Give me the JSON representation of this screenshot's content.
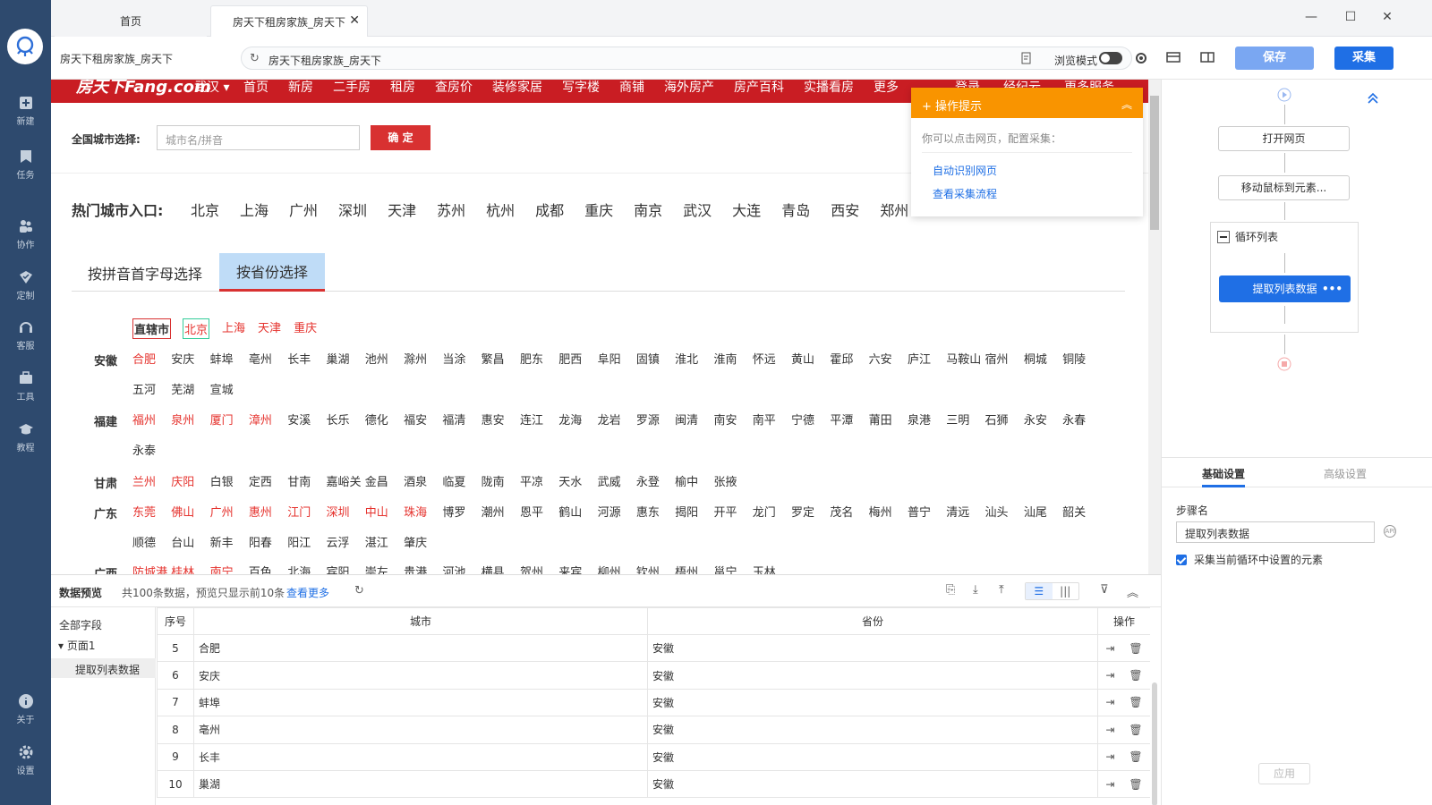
{
  "tabs": {
    "home": "首页",
    "active": "房天下租房家族_房天下"
  },
  "address": {
    "title": "房天下租房家族_房天下",
    "url": "房天下租房家族_房天下",
    "browse_mode": "浏览模式"
  },
  "toolbar": {
    "save_label": "保存",
    "collect_label": "采集"
  },
  "sidebar": {
    "items": [
      {
        "label": "新建",
        "icon": "new-icon"
      },
      {
        "label": "任务",
        "icon": "task-icon"
      },
      {
        "label": "协作",
        "icon": "collab-icon"
      },
      {
        "label": "定制",
        "icon": "custom-icon"
      },
      {
        "label": "客服",
        "icon": "headset-icon"
      },
      {
        "label": "工具",
        "icon": "toolbox-icon"
      },
      {
        "label": "教程",
        "icon": "tutorial-icon"
      },
      {
        "label": "关于",
        "icon": "info-icon"
      },
      {
        "label": "设置",
        "icon": "gear-icon"
      }
    ]
  },
  "site": {
    "logo": "房天下Fang.com",
    "city": "武汉",
    "nav": [
      "首页",
      "新房",
      "二手房",
      "租房",
      "查房价",
      "装修家居",
      "写字楼",
      "商铺",
      "海外房产",
      "房产百科",
      "实播看房",
      "更多"
    ],
    "nav_right": [
      "登录",
      "经纪云",
      "更多服务"
    ],
    "city_select_label": "全国城市选择:",
    "city_input_placeholder": "城市名/拼音",
    "confirm": "确 定",
    "hot_label": "热门城市入口:",
    "hot_cities": [
      "北京",
      "上海",
      "广州",
      "深圳",
      "天津",
      "苏州",
      "杭州",
      "成都",
      "重庆",
      "南京",
      "武汉",
      "大连",
      "青岛",
      "西安",
      "郑州"
    ],
    "tab_pinyin": "按拼音首字母选择",
    "tab_province": "按省份选择",
    "direct_label": "直辖市",
    "direct_cities": [
      "北京",
      "上海",
      "天津",
      "重庆"
    ],
    "provinces": [
      {
        "name": "安徽",
        "rows": [
          [
            "合肥",
            "安庆",
            "蚌埠",
            "亳州",
            "长丰",
            "巢湖",
            "池州",
            "滁州",
            "当涂",
            "繁昌",
            "肥东",
            "肥西",
            "阜阳",
            "固镇",
            "淮北",
            "淮南",
            "怀远",
            "黄山",
            "霍邱",
            "六安",
            "庐江",
            "马鞍山",
            "宿州",
            "桐城",
            "铜陵"
          ],
          [
            "五河",
            "芜湖",
            "宣城"
          ]
        ],
        "red_count": 1
      },
      {
        "name": "福建",
        "rows": [
          [
            "福州",
            "泉州",
            "厦门",
            "漳州",
            "安溪",
            "长乐",
            "德化",
            "福安",
            "福清",
            "惠安",
            "连江",
            "龙海",
            "龙岩",
            "罗源",
            "闽清",
            "南安",
            "南平",
            "宁德",
            "平潭",
            "莆田",
            "泉港",
            "三明",
            "石狮",
            "永安",
            "永春"
          ],
          [
            "永泰"
          ]
        ],
        "red_count": 4
      },
      {
        "name": "甘肃",
        "rows": [
          [
            "兰州",
            "庆阳",
            "白银",
            "定西",
            "甘南",
            "嘉峪关",
            "金昌",
            "酒泉",
            "临夏",
            "陇南",
            "平凉",
            "天水",
            "武威",
            "永登",
            "榆中",
            "张掖"
          ]
        ],
        "red_count": 2
      },
      {
        "name": "广东",
        "rows": [
          [
            "东莞",
            "佛山",
            "广州",
            "惠州",
            "江门",
            "深圳",
            "中山",
            "珠海",
            "博罗",
            "潮州",
            "恩平",
            "鹤山",
            "河源",
            "惠东",
            "揭阳",
            "开平",
            "龙门",
            "罗定",
            "茂名",
            "梅州",
            "普宁",
            "清远",
            "汕头",
            "汕尾",
            "韶关"
          ],
          [
            "顺德",
            "台山",
            "新丰",
            "阳春",
            "阳江",
            "云浮",
            "湛江",
            "肇庆"
          ]
        ],
        "red_count": 8
      },
      {
        "name": "广西",
        "rows": [
          [
            "防城港",
            "桂林",
            "南宁",
            "百色",
            "北海",
            "宾阳",
            "崇左",
            "贵港",
            "河池",
            "横县",
            "贺州",
            "来宾",
            "柳州",
            "钦州",
            "梧州",
            "邕宁",
            "玉林"
          ]
        ],
        "red_count": 3
      }
    ]
  },
  "tips": {
    "title": "操作提示",
    "desc": "你可以点击网页，配置采集：",
    "link1": "自动识别网页",
    "link2": "查看采集流程"
  },
  "flow": {
    "open_page": "打开网页",
    "move_mouse": "移动鼠标到元素...",
    "loop": "循环列表",
    "extract": "提取列表数据"
  },
  "settings": {
    "tab_basic": "基础设置",
    "tab_advanced": "高级设置",
    "step_label": "步骤名",
    "step_value": "提取列表数据",
    "checkbox_label": "采集当前循环中设置的元素",
    "apply": "应用"
  },
  "preview": {
    "title": "数据预览",
    "info": "共100条数据，预览只显示前10条",
    "more": "查看更多",
    "fields_all": "全部字段",
    "page": "页面1",
    "field_item": "提取列表数据",
    "columns": {
      "idx": "序号",
      "city": "城市",
      "province": "省份",
      "ops": "操作"
    },
    "rows": [
      {
        "idx": "5",
        "city": "合肥",
        "province": "安徽"
      },
      {
        "idx": "6",
        "city": "安庆",
        "province": "安徽"
      },
      {
        "idx": "7",
        "city": "蚌埠",
        "province": "安徽"
      },
      {
        "idx": "8",
        "city": "亳州",
        "province": "安徽"
      },
      {
        "idx": "9",
        "city": "长丰",
        "province": "安徽"
      },
      {
        "idx": "10",
        "city": "巢湖",
        "province": "安徽"
      }
    ]
  }
}
